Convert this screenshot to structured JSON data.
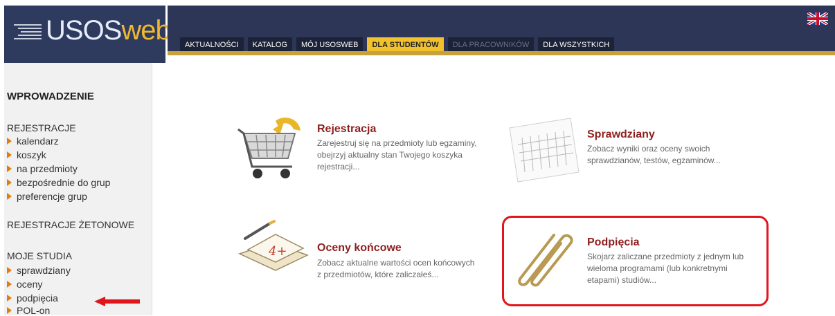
{
  "header": {
    "logo_main": "USOS",
    "logo_accent": "web",
    "tabs": [
      {
        "label": "AKTUALNOŚCI"
      },
      {
        "label": "KATALOG"
      },
      {
        "label": "MÓJ USOSWEB"
      },
      {
        "label": "DLA STUDENTÓW",
        "active": true
      },
      {
        "label": "DLA PRACOWNIKÓW",
        "disabled": true
      },
      {
        "label": "DLA WSZYSTKICH"
      }
    ],
    "language_flag": "uk-flag-icon"
  },
  "sidebar": {
    "intro": "WPROWADZENIE",
    "registrations": {
      "heading": "REJESTRACJE",
      "items": [
        "kalendarz",
        "koszyk",
        "na przedmioty",
        "bezpośrednie do grup",
        "preferencje grup"
      ]
    },
    "token_registrations": "REJESTRACJE ŻETONOWE",
    "my_studies": {
      "heading": "MOJE STUDIA",
      "items": [
        "sprawdziany",
        "oceny",
        "podpięcia",
        "POL-on"
      ]
    }
  },
  "cards": {
    "rejestracja": {
      "title": "Rejestracja",
      "desc1": "Zarejestruj się na przedmioty lub egzaminy,",
      "desc2": "obejrzyj aktualny stan Twojego koszyka",
      "desc3": "rejestracji..."
    },
    "sprawdziany": {
      "title": "Sprawdziany",
      "desc1": "Zobacz wyniki oraz oceny swoich",
      "desc2": "sprawdzianów, testów, egzaminów..."
    },
    "oceny": {
      "title": "Oceny końcowe",
      "desc1": "Zobacz aktualne wartości ocen końcowych",
      "desc2": "z przedmiotów, które zaliczałeś..."
    },
    "podpiecia": {
      "title": "Podpięcia",
      "desc1": "Skojarz zaliczane przedmioty z jednym lub",
      "desc2": "wieloma programami (lub konkretnymi",
      "desc3": "etapami) studiów..."
    },
    "grade_icon_text": "4+"
  },
  "colors": {
    "nav": "#2d3656",
    "active_tab": "#f2c12e",
    "title": "#8f1f1f",
    "bullet": "#e27b12",
    "highlight": "#e0161d"
  }
}
